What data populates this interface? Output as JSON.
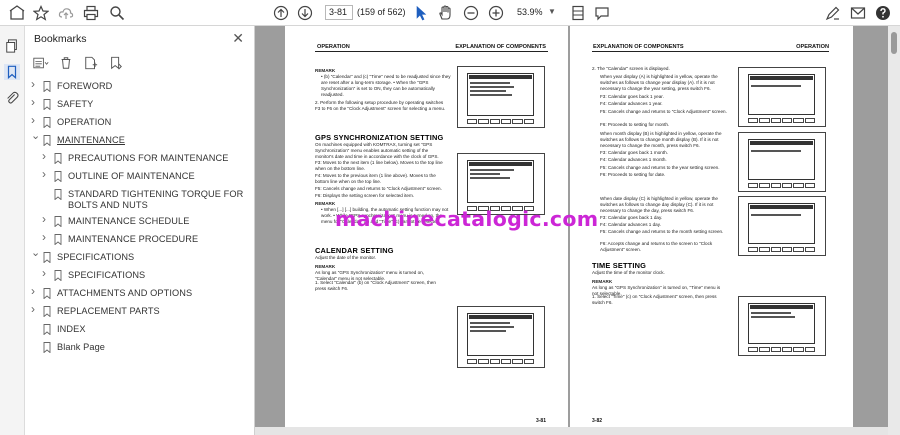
{
  "toolbar": {
    "page_current": "3-81",
    "page_count": "(159 of 562)",
    "zoom": "53.9%"
  },
  "panel": {
    "title": "Bookmarks"
  },
  "bookmarks": [
    {
      "label": "FOREWORD"
    },
    {
      "label": "SAFETY"
    },
    {
      "label": "OPERATION"
    },
    {
      "label": "MAINTENANCE"
    },
    {
      "label": "PRECAUTIONS FOR MAINTENANCE"
    },
    {
      "label": "OUTLINE OF MAINTENANCE"
    },
    {
      "label": "STANDARD TIGHTENING TORQUE FOR BOLTS AND NUTS"
    },
    {
      "label": "MAINTENANCE SCHEDULE"
    },
    {
      "label": "MAINTENANCE PROCEDURE"
    },
    {
      "label": "SPECIFICATIONS"
    },
    {
      "label": "SPECIFICATIONS"
    },
    {
      "label": "ATTACHMENTS AND OPTIONS"
    },
    {
      "label": "REPLACEMENT PARTS"
    },
    {
      "label": "INDEX"
    },
    {
      "label": "Blank Page"
    }
  ],
  "left_page": {
    "header_left": "OPERATION",
    "header_right": "EXPLANATION OF COMPONENTS",
    "remark1": "REMARK",
    "remark1_lines": "• (b) \"Calendar\" and (c) \"Time\" need to be readjusted since they are reset after a long-term storage. • When the \"GPS Synchronization\" is set to ON, they can be automatically readjusted.",
    "step2": "2. Perform the following setup procedure by operating switches F3 to F6 on the \"Clock Adjustment\" screen for selecting a menu.",
    "gps_title": "GPS SYNCHRONIZATION SETTING",
    "gps_body": "On machines equipped with KOMTRAX, turning set \"GPS Synchronization\" menu enables automatic setting of the monitor's date and time in accordance with the clock of GPS.",
    "f3": "F3: Moves to the next item (1 line below). Moves to the top line when on the bottom line.",
    "f4": "F4: Moves to the previous item (1 line above). Moves to the bottom line when on the top line.",
    "f5": "F5: Cancels change and returns to \"Clock Adjustment\" screen.",
    "f6": "F6: Displays the setting screen for selected item.",
    "remark2": "REMARK",
    "remark2_lines": "• When [...] [...] building, the automatic setting function may not work. • While \"GPS synchronization\" menu is turned on, the menu for \"Calendar\" (b) and \"Time\" (c) cannot be selected.",
    "cal_title": "CALENDAR SETTING",
    "cal_body": "Adjust the date of the monitor.",
    "remark3": "REMARK",
    "remark3_line": "As long as \"GPS Synchronization\" menu is turned on, \"Calendar\" menu is not selectable.",
    "step1": "1. Select \"Calendar\" (b) on \"Clock Adjustment\" screen, then press switch F6.",
    "page_number": "3-81"
  },
  "right_page": {
    "header_left": "EXPLANATION OF COMPONENTS",
    "header_right": "OPERATION",
    "step2": "2. The \"Calendar\" screen is displayed.",
    "year": "When year display (A) is highlighted in yellow, operate the switches as follows to change year display (A). If it is not necessary to change the year setting, press switch F6.",
    "year_f3": "F3: Calendar goes back 1 year.",
    "year_f4": "F4: Calendar advances 1 year.",
    "year_f5": "F5: Cancels change and returns to \"Clock Adjustment\" screen.",
    "year_f6": "F6: Proceeds to setting for month.",
    "month": "When month display (B) is highlighted in yellow, operate the switches as follows to change month display (B). If it is not necessary to change the month, press switch F6.",
    "month_f3": "F3: Calendar goes back 1 month.",
    "month_f4": "F4: Calendar advances 1 month.",
    "month_f5": "F5: Cancels change and returns to the year setting screen.",
    "month_f6": "F6: Proceeds to setting for date.",
    "date": "When date display (C) is highlighted in yellow, operate the switches as follows to change day display (C). If it is not necessary to change the day, press switch F6.",
    "date_f3": "F3: Calendar goes back 1 day.",
    "date_f4": "F4: Calendar advances 1 day.",
    "date_f5": "F5: Cancels change and returns to the month setting screen.",
    "date_f6": "F6: Accepts change and returns to the screen to \"Clock Adjustment\" screen.",
    "time_title": "TIME SETTING",
    "time_body": "Adjust the time of the monitor clock.",
    "remark": "REMARK",
    "remark_line": "As long as \"GPS Synchronization\" is turned on, \"Time\" menu is not selectable.",
    "step1": "1. Select \"Time\" (c) on \"Clock Adjustment\" screen, then press switch F6.",
    "page_number": "3-82"
  },
  "watermark": "machinecatalogic.com"
}
